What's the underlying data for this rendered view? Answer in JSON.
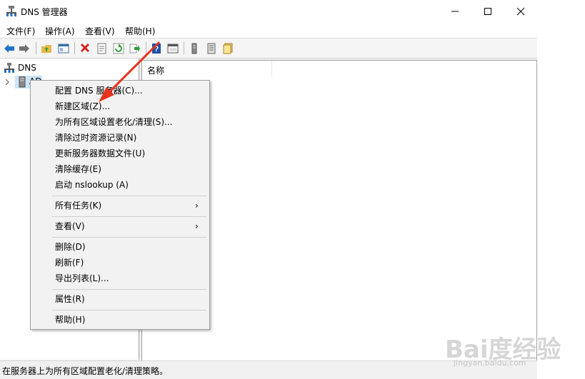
{
  "window": {
    "title": "DNS 管理器"
  },
  "menubar": [
    "文件(F)",
    "操作(A)",
    "查看(V)",
    "帮助(H)"
  ],
  "tree": {
    "root": "DNS",
    "server": "AD"
  },
  "list": {
    "column_name": "名称"
  },
  "context_menu": {
    "items": [
      "配置 DNS 服务器(C)...",
      "新建区域(Z)...",
      "为所有区域设置老化/清理(S)...",
      "清除过时资源记录(N)",
      "更新服务器数据文件(U)",
      "清除缓存(E)",
      "启动 nslookup (A)"
    ],
    "all_tasks": "所有任务(K)",
    "view": "查看(V)",
    "actions": [
      "删除(D)",
      "刷新(F)",
      "导出列表(L)..."
    ],
    "properties": "属性(R)",
    "help": "帮助(H)",
    "submenu_arrow": "›"
  },
  "status": {
    "text": "在服务器上为所有区域配置老化/清理策略。"
  },
  "watermark": {
    "logo": "Bai度经验",
    "url": "jingyan.baidu.com"
  },
  "colors": {
    "accent_arrow": "#e8321e",
    "toolbar_blue": "#1e73c8",
    "toolbar_red": "#d42020",
    "toolbar_green": "#2e9e3a"
  },
  "icons": [
    "dns-icon",
    "back-arrow-icon",
    "forward-arrow-icon",
    "up-folder-icon",
    "show-pane-icon",
    "delete-icon",
    "properties-icon",
    "refresh-icon",
    "export-icon",
    "help-icon",
    "console-icon",
    "server-icon",
    "list-icon",
    "zone-icon",
    "server-tree-icon",
    "expand-chevron-icon"
  ]
}
